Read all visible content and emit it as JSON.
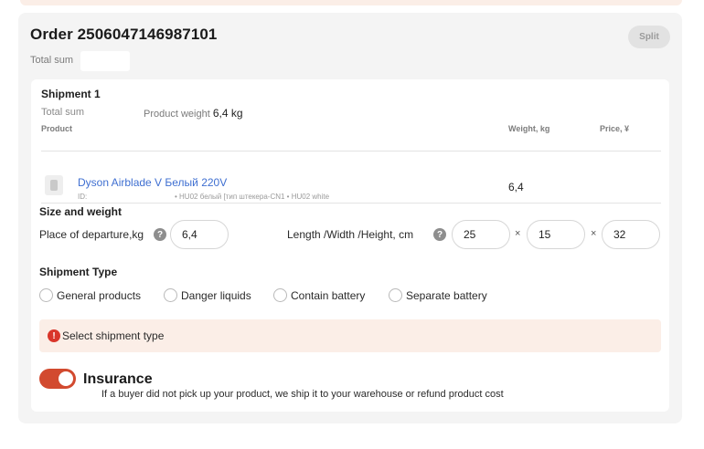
{
  "order": {
    "title": "Order 2506047146987101",
    "total_label": "Total sum",
    "split_label": "Split"
  },
  "shipment": {
    "title": "Shipment 1",
    "total_label": "Total sum",
    "weight_label": "Product weight",
    "weight_value": "6,4 kg",
    "columns": {
      "product": "Product",
      "weight": "Weight, kg",
      "price": "Price, ¥"
    },
    "product": {
      "name": "Dyson Airblade V Белый 220V",
      "id_label": "ID:",
      "variant": "• HU02 белый [тип штекера-CN1  • HU02 white",
      "weight": "6,4",
      "thumb_icon": "product-thumbnail-icon"
    }
  },
  "size_weight": {
    "title": "Size and weight",
    "departure_label": "Place of departure,kg",
    "departure_value": "6,4",
    "dims_label": "Length /Width /Height, cm",
    "length": "25",
    "width": "15",
    "height": "32",
    "separator": "×",
    "help_icon": "?"
  },
  "shipment_type": {
    "title": "Shipment Type",
    "options": [
      "General products",
      "Danger liquids",
      "Contain battery",
      "Separate battery"
    ],
    "alert": "Select shipment type",
    "alert_icon": "!"
  },
  "insurance": {
    "title": "Insurance",
    "enabled": true,
    "description": "If a buyer did not pick up your product, we ship it to your warehouse or refund product cost"
  },
  "colors": {
    "accent": "#d24a2f",
    "link": "#3f6fd1",
    "alert_bg": "#fbeee7",
    "card_bg": "#f4f4f4"
  }
}
